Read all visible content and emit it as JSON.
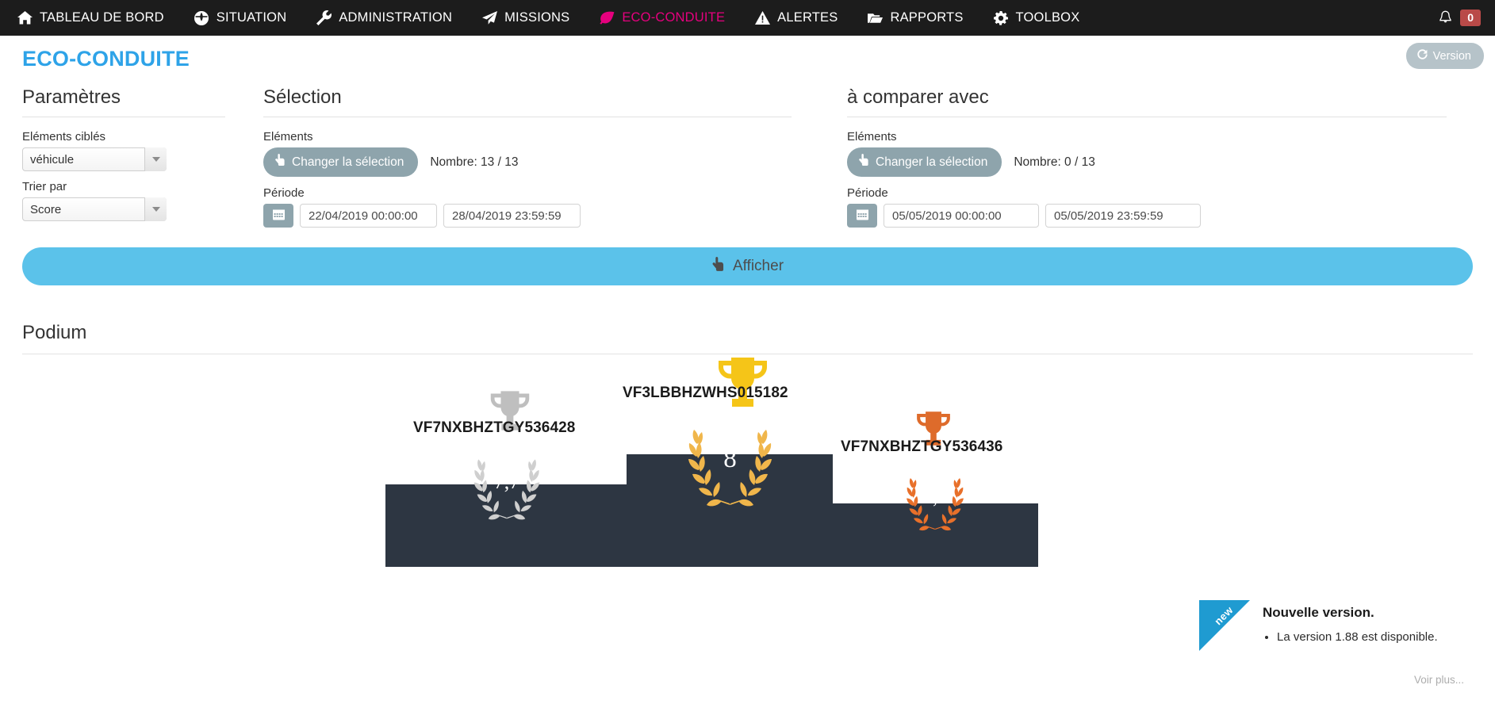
{
  "navbar": {
    "items": [
      {
        "label": "TABLEAU DE BORD",
        "icon": "home-icon",
        "active": false
      },
      {
        "label": "SITUATION",
        "icon": "globe-icon",
        "active": false
      },
      {
        "label": "ADMINISTRATION",
        "icon": "wrench-icon",
        "active": false
      },
      {
        "label": "MISSIONS",
        "icon": "paper-plane-icon",
        "active": false
      },
      {
        "label": "ECO-CONDUITE",
        "icon": "leaf-icon",
        "active": true
      },
      {
        "label": "ALERTES",
        "icon": "warning-triangle-icon",
        "active": false
      },
      {
        "label": "RAPPORTS",
        "icon": "folder-open-icon",
        "active": false
      },
      {
        "label": "TOOLBOX",
        "icon": "gear-icon",
        "active": false
      }
    ],
    "notification_count": "0",
    "active_color": "#e6007e",
    "background": "#1c1c1c",
    "badge_color": "#b94a48"
  },
  "header": {
    "title": "ECO-CONDUITE",
    "title_color": "#2ea3e8",
    "version_button": "Version"
  },
  "parameters": {
    "section_title": "Paramètres",
    "targeted_label": "Eléments ciblés",
    "targeted_value": "véhicule",
    "sort_label": "Trier par",
    "sort_value": "Score"
  },
  "selection": {
    "section_title": "Sélection",
    "elements_label": "Eléments",
    "change_button": "Changer la sélection",
    "count_text": "Nombre: 13 / 13",
    "period_label": "Période",
    "date_start": "22/04/2019 00:00:00",
    "date_end": "28/04/2019 23:59:59"
  },
  "compare": {
    "section_title": "à comparer avec",
    "elements_label": "Eléments",
    "change_button": "Changer la sélection",
    "count_text": "Nombre: 0 / 13",
    "period_label": "Période",
    "date_start": "05/05/2019 00:00:00",
    "date_end": "05/05/2019 23:59:59"
  },
  "display_button": {
    "label": "Afficher",
    "color": "#5bc2ea"
  },
  "podium": {
    "section_title": "Podium",
    "block_color": "#2d3642",
    "entries": [
      {
        "rank": 1,
        "name": "VF3LBBHZWHS015182",
        "score": "8",
        "medal": "gold",
        "color": "#f5c518"
      },
      {
        "rank": 2,
        "name": "VF7NXBHZTGY536428",
        "score": "7,7",
        "medal": "silver",
        "color": "#bfbfbf"
      },
      {
        "rank": 3,
        "name": "VF7NXBHZTGY536436",
        "score": "7,7",
        "medal": "bronze",
        "color": "#de6b2b"
      }
    ]
  },
  "new_version": {
    "ribbon": "new",
    "title": "Nouvelle version.",
    "items": [
      "La version 1.88 est disponible."
    ],
    "more_link": "Voir plus...",
    "ribbon_color": "#1f9bd1"
  }
}
